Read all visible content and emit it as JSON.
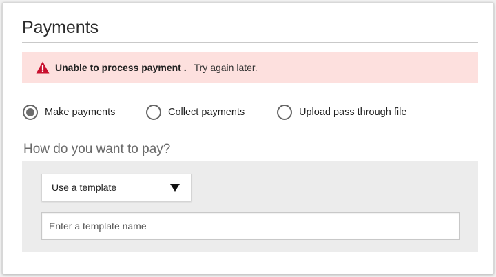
{
  "header": {
    "title": "Payments"
  },
  "alert": {
    "icon": "warning-icon",
    "message_strong": "Unable to process payment .",
    "message": "Try again later.",
    "background_color": "#fde0de",
    "icon_color": "#c8102e"
  },
  "payment_type": {
    "options": [
      {
        "label": "Make payments",
        "selected": true
      },
      {
        "label": "Collect payments",
        "selected": false
      },
      {
        "label": "Upload pass through file",
        "selected": false
      }
    ]
  },
  "pay_method": {
    "question": "How do you want to pay?",
    "select_value": "Use a template",
    "template_placeholder": "Enter a template name",
    "template_value": ""
  }
}
